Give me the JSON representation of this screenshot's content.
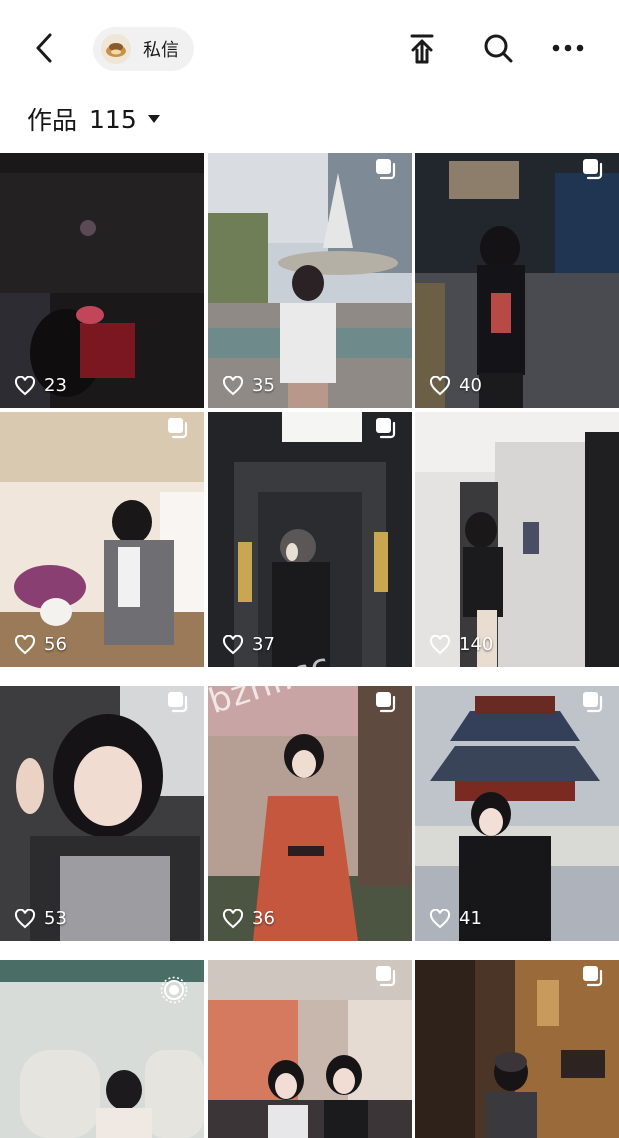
{
  "header": {
    "dm_label": "私信",
    "icons": [
      "back-icon",
      "share-icon",
      "search-icon",
      "more-icon",
      "avatar"
    ]
  },
  "works": {
    "label": "作品",
    "count": "115",
    "dropdown_icon": "caret-down-icon"
  },
  "grid": {
    "tiles": [
      {
        "likes": "23",
        "badge": "none"
      },
      {
        "likes": "35",
        "badge": "image-set-icon"
      },
      {
        "likes": "40",
        "badge": "image-set-icon"
      },
      {
        "likes": "56",
        "badge": "image-set-icon"
      },
      {
        "likes": "37",
        "badge": "image-set-icon"
      },
      {
        "likes": "140",
        "badge": "none"
      },
      {
        "likes": "53",
        "badge": "image-set-icon"
      },
      {
        "likes": "36",
        "badge": "image-set-icon"
      },
      {
        "likes": "41",
        "badge": "image-set-icon"
      },
      {
        "likes": "",
        "badge": "live-photo-icon"
      },
      {
        "likes": "",
        "badge": "image-set-icon"
      },
      {
        "likes": "",
        "badge": "image-set-icon"
      }
    ]
  },
  "watermark": "bzhl.cc"
}
